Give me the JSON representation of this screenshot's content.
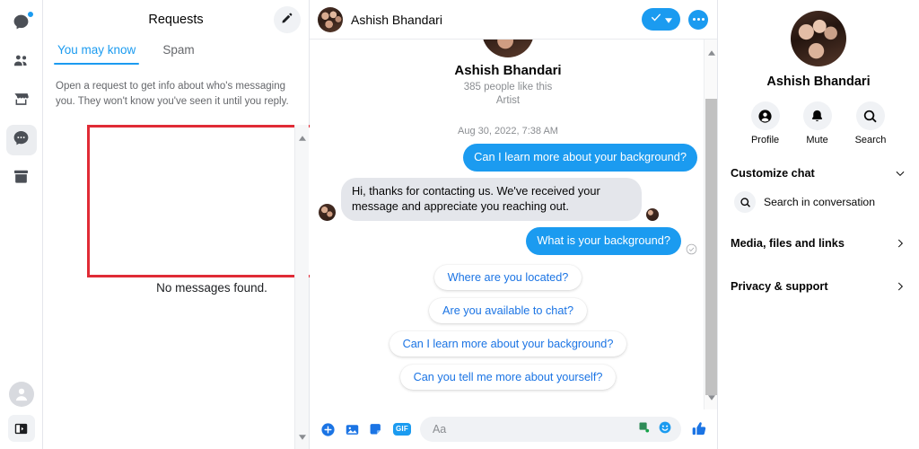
{
  "rail": {
    "items": [
      {
        "name": "chats-notification",
        "icon": "chat-bubble-icon",
        "badge": true,
        "active": false
      },
      {
        "name": "people",
        "icon": "people-icon",
        "badge": false,
        "active": false
      },
      {
        "name": "marketplace",
        "icon": "store-icon",
        "badge": false,
        "active": false
      },
      {
        "name": "messages",
        "icon": "message-dots-icon",
        "badge": false,
        "active": true
      },
      {
        "name": "archive",
        "icon": "archive-box-icon",
        "badge": false,
        "active": false
      }
    ],
    "account_icon": "account-avatar-icon",
    "panel_toggle_icon": "sidebar-toggle-icon"
  },
  "requests": {
    "title": "Requests",
    "edit_icon": "pencil-icon",
    "tabs": [
      {
        "label": "You may know",
        "active": true
      },
      {
        "label": "Spam",
        "active": false
      }
    ],
    "note": "Open a request to get info about who's messaging you. They won't know you've seen it until you reply.",
    "empty_text": "No messages found.",
    "highlight_color": "#e02b36",
    "scrollbar": {
      "up_icon": "scroll-up-arrow-icon",
      "down_icon": "scroll-down-arrow-icon"
    }
  },
  "chat": {
    "header": {
      "name": "Ashish Bhandari",
      "avatar_name": "contact-avatar",
      "confirm_icon": "check-icon",
      "confirm_caret_icon": "caret-down-icon",
      "more_icon": "more-options-icon",
      "accent_color": "#1b9bf0"
    },
    "profile": {
      "name": "Ashish Bhandari",
      "likes": "385 people like this",
      "category": "Artist"
    },
    "date_divider": "Aug 30, 2022, 7:38 AM",
    "messages": [
      {
        "side": "out",
        "text": "Can I learn more about your background?",
        "seen": false,
        "delivered": false
      },
      {
        "side": "in",
        "text": "Hi, thanks for contacting us. We've received your message and appreciate you reaching out.",
        "seen": true,
        "delivered": false
      },
      {
        "side": "out",
        "text": "What is your background?",
        "seen": false,
        "delivered": true
      }
    ],
    "suggestions": [
      "Where are you located?",
      "Are you available to chat?",
      "Can I learn more about your background?",
      "Can you tell me more about yourself?"
    ],
    "composer": {
      "placeholder": "Aa",
      "left_icons": [
        "plus-circle-icon",
        "photo-icon",
        "sticker-icon",
        "gif-icon"
      ],
      "gif_label": "GIF",
      "right_icons": [
        "green-sticker-icon",
        "emoji-icon"
      ],
      "send_icon": "thumbs-up-icon"
    }
  },
  "details": {
    "name": "Ashish Bhandari",
    "avatar_name": "contact-avatar-large",
    "actions": [
      {
        "label": "Profile",
        "icon": "profile-icon"
      },
      {
        "label": "Mute",
        "icon": "bell-icon"
      },
      {
        "label": "Search",
        "icon": "search-icon"
      }
    ],
    "sections": [
      {
        "label": "Customize chat",
        "chevron": "chevron-down-icon"
      },
      {
        "label": "Media, files and links",
        "chevron": "chevron-right-icon"
      },
      {
        "label": "Privacy & support",
        "chevron": "chevron-right-icon"
      }
    ],
    "search_in_conversation": "Search in conversation",
    "search_icon": "search-icon"
  }
}
